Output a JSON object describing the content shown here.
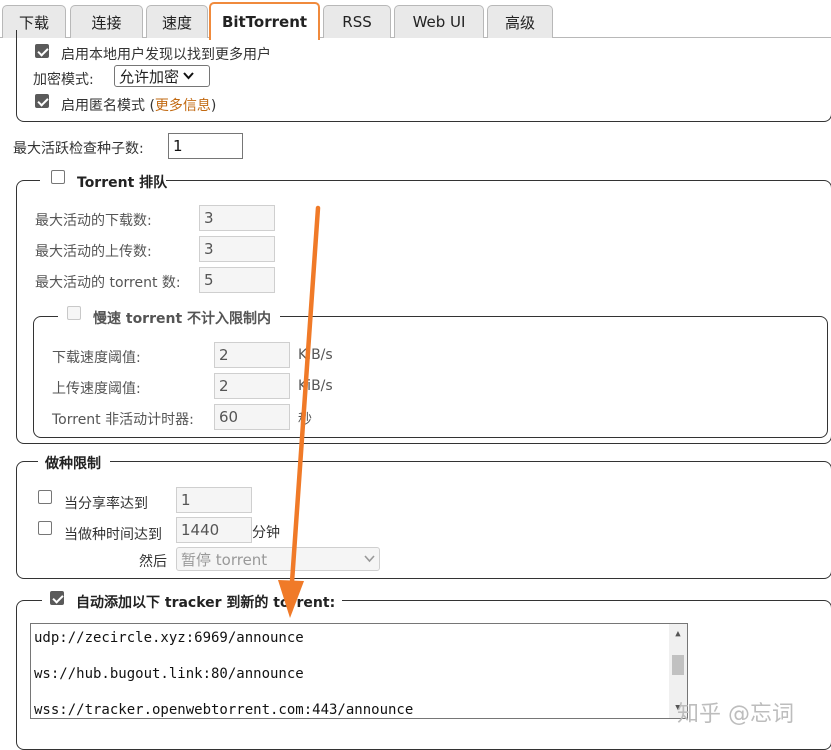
{
  "tabs": [
    {
      "label": "下载",
      "active": false
    },
    {
      "label": "连接",
      "active": false
    },
    {
      "label": "速度",
      "active": false
    },
    {
      "label": "BitTorrent",
      "active": true
    },
    {
      "label": "RSS",
      "active": false
    },
    {
      "label": "Web UI",
      "active": false
    },
    {
      "label": "高级",
      "active": false
    }
  ],
  "privacy": {
    "local_discovery": {
      "label": "启用本地用户发现以找到更多用户",
      "checked": true
    },
    "encryption_label": "加密模式:",
    "encryption_value": "允许加密",
    "anonymous": {
      "label_prefix": "启用匿名模式 (",
      "link": "更多信息",
      "label_suffix": ")",
      "checked": true
    }
  },
  "max_active_checking": {
    "label": "最大活跃检查种子数:",
    "value": "1"
  },
  "queueing": {
    "legend": "Torrent 排队",
    "checked": false,
    "max_downloads": {
      "label": "最大活动的下载数:",
      "value": "3"
    },
    "max_uploads": {
      "label": "最大活动的上传数:",
      "value": "3"
    },
    "max_torrents": {
      "label": "最大活动的 torrent 数:",
      "value": "5"
    },
    "slow": {
      "legend": "慢速 torrent 不计入限制内",
      "checked": false,
      "download_threshold": {
        "label": "下载速度阈值:",
        "value": "2",
        "unit": "KiB/s"
      },
      "upload_threshold": {
        "label": "上传速度阈值:",
        "value": "2",
        "unit": "KiB/s"
      },
      "inactive_timer": {
        "label": "Torrent 非活动计时器:",
        "value": "60",
        "unit": "秒"
      }
    }
  },
  "seeding": {
    "legend": "做种限制",
    "ratio": {
      "label": "当分享率达到",
      "value": "1",
      "checked": false
    },
    "time": {
      "label": "当做种时间达到",
      "value": "1440",
      "unit": "分钟",
      "checked": false
    },
    "then_label": "然后",
    "then_value": "暂停 torrent"
  },
  "trackers": {
    "legend": "自动添加以下 tracker 到新的 torrent:",
    "checked": true,
    "lines": [
      "udp://zecircle.xyz:6969/announce",
      "ws://hub.bugout.link:80/announce",
      "wss://tracker.openwebtorrent.com:443/announce"
    ]
  },
  "watermark": "知乎 @忘词",
  "colors": {
    "accent": "#f08a3c",
    "link": "#c26a12",
    "arrow": "#f07a28"
  }
}
